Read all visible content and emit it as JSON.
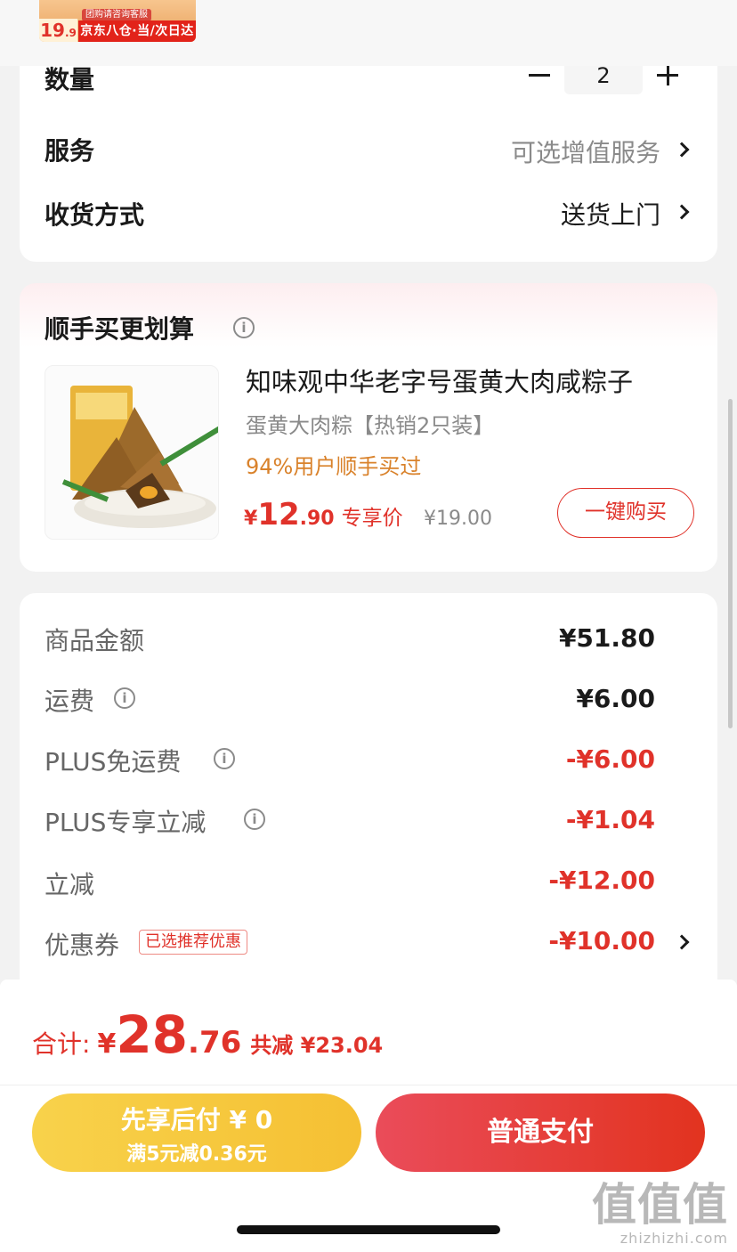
{
  "thumbnail": {
    "price_int": "19",
    "price_dec": ".9",
    "note": "团购请咨询客服",
    "badge": "京东八仓·当/次日达"
  },
  "order": {
    "quantity_label": "数量",
    "quantity_value": "2",
    "service_label": "服务",
    "service_value": "可选增值服务",
    "delivery_label": "收货方式",
    "delivery_value": "送货上门"
  },
  "addon": {
    "title": "顺手买更划算",
    "info_icon": "info-circle",
    "product": {
      "title": "知味观中华老字号蛋黄大肉咸粽子",
      "subtitle": "蛋黄大肉粽【热销2只装】",
      "stat": "94%用户顺手买过",
      "price_currency": "¥",
      "price_int": "12",
      "price_dec": ".90",
      "price_label": "专享价",
      "original_price": "¥19.00",
      "buy_button": "一键购买"
    }
  },
  "summary": {
    "rows": [
      {
        "label": "商品金额",
        "value": "¥51.80",
        "red": false,
        "info": false
      },
      {
        "label": "运费",
        "value": "¥6.00",
        "red": false,
        "info": true
      },
      {
        "label": "PLUS免运费",
        "value": "-¥6.00",
        "red": true,
        "info": true
      },
      {
        "label": "PLUS专享立减",
        "value": "-¥1.04",
        "red": true,
        "info": true
      },
      {
        "label": "立减",
        "value": "-¥12.00",
        "red": true,
        "info": false
      },
      {
        "label": "优惠券",
        "value": "-¥10.00",
        "red": true,
        "info": false
      }
    ],
    "coupon_tag": "已选推荐优惠"
  },
  "footer": {
    "total_label": "合计:",
    "total_currency": "¥",
    "total_int": "28",
    "total_dec": ".76",
    "total_saved": "共减 ¥23.04",
    "pay_later_line1": "先享后付 ¥ 0",
    "pay_later_line2": "满5元减0.36元",
    "pay_button": "普通支付"
  },
  "watermark": {
    "big": "值值值",
    "small": "zhizhizhi.com"
  },
  "colors": {
    "accent_red": "#e0322a",
    "stat_orange": "#d9822b",
    "pay_later_yellow": "#f5c033",
    "pay_red": "#e2331f"
  }
}
